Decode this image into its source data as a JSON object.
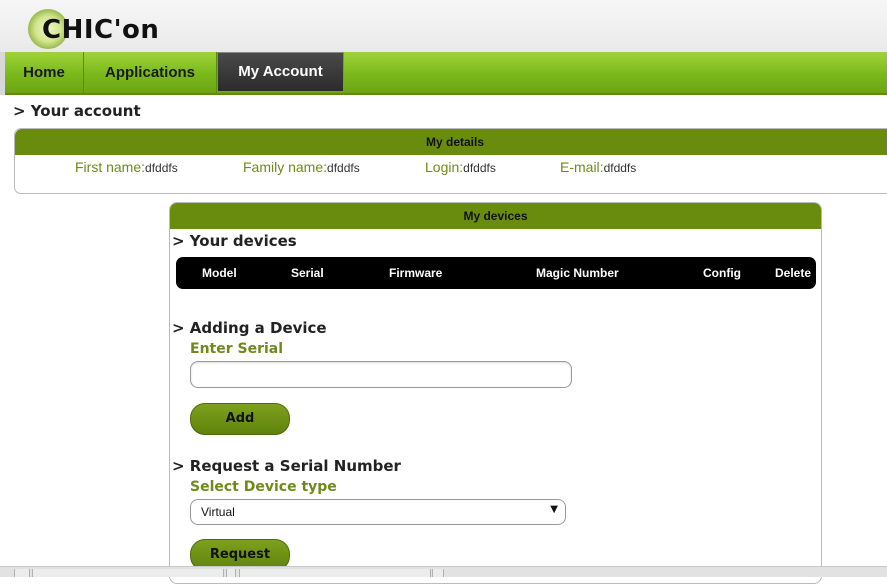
{
  "app": {
    "logo_text": "CHIC'on"
  },
  "nav": {
    "items": [
      {
        "label": "Home"
      },
      {
        "label": "Applications"
      },
      {
        "label": "My Account"
      }
    ],
    "active": "My Account"
  },
  "account": {
    "heading": "> Your account",
    "details_title": "My details",
    "fields": [
      {
        "key": "First name:",
        "value": "dfddfs"
      },
      {
        "key": "Family name:",
        "value": "dfddfs"
      },
      {
        "key": "Login:",
        "value": "dfddfs"
      },
      {
        "key": "E-mail:",
        "value": "dfddfs"
      }
    ]
  },
  "devices": {
    "panel_title": "My devices",
    "your_devices_heading": "> Your devices",
    "columns": [
      "Model",
      "Serial",
      "Firmware",
      "Magic Number",
      "Config",
      "Delete"
    ],
    "adding_heading": "> Adding a Device",
    "serial_label": "Enter Serial",
    "serial_value": "",
    "add_button": "Add",
    "request_heading": "> Request a Serial Number",
    "device_type_label": "Select Device type",
    "device_type_selected": "Virtual",
    "request_button": "Request"
  },
  "colors": {
    "accent_green": "#79b81a",
    "panel_header": "#6a8c0e",
    "label_green": "#6e8a1a",
    "table_header": "#000000"
  }
}
